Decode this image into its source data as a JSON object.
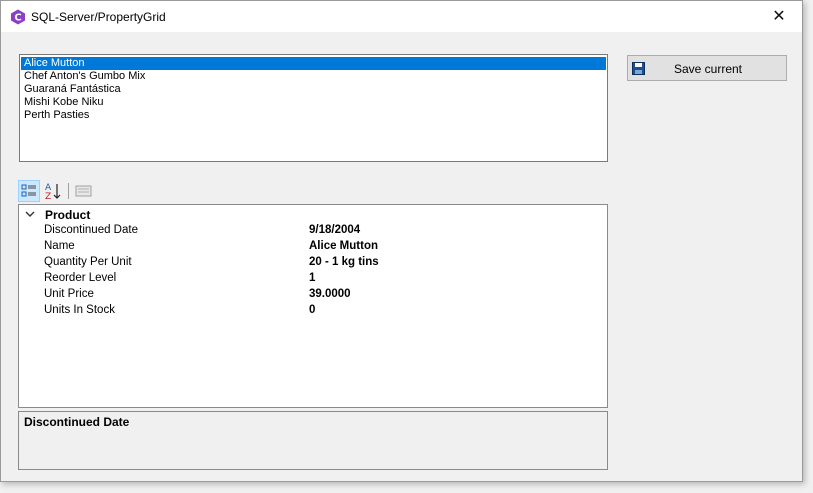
{
  "window": {
    "title": "SQL-Server/PropertyGrid",
    "close_symbol": "✕"
  },
  "list": {
    "items": [
      "Alice Mutton",
      "Chef Anton's Gumbo Mix",
      "Guaraná Fantástica",
      "Mishi Kobe Niku",
      "Perth Pasties"
    ],
    "selected_index": 0
  },
  "save_button": {
    "label": "Save current",
    "icon": "floppy-disk-icon"
  },
  "toolbar": {
    "buttons": [
      "categorized-icon",
      "alphabetical-sort-icon",
      "property-pages-icon"
    ]
  },
  "property_grid": {
    "category": "Product",
    "properties": [
      {
        "name": "Discontinued Date",
        "value": "9/18/2004"
      },
      {
        "name": "Name",
        "value": "Alice Mutton"
      },
      {
        "name": "Quantity Per Unit",
        "value": "20 - 1 kg tins"
      },
      {
        "name": "Reorder Level",
        "value": "1"
      },
      {
        "name": "Unit Price",
        "value": "39.0000"
      },
      {
        "name": "Units In Stock",
        "value": "0"
      }
    ]
  },
  "help_panel": {
    "title": "Discontinued Date"
  },
  "colors": {
    "selection": "#0078d7",
    "app_icon": "#8a3fc7",
    "toolbar_active": "#cce8ff"
  }
}
